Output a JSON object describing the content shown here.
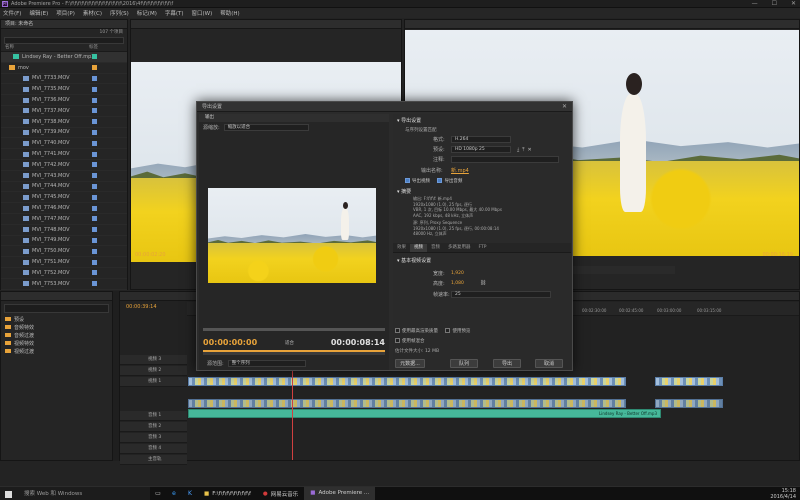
{
  "titlebar": {
    "title": "Adobe Premiere Pro - F:\\f\\f\\f\\f\\f\\f\\f\\f\\f\\f\\f\\f\\f\\f\\f\\2016\\4f\\f\\f\\f\\f\\f\\f\\f\\f\\f",
    "min": "—",
    "max": "☐",
    "close": "✕"
  },
  "menu": [
    "文件(F)",
    "编辑(E)",
    "项目(P)",
    "素材(C)",
    "序列(S)",
    "标记(M)",
    "字幕(T)",
    "窗口(W)",
    "帮助(H)"
  ],
  "project": {
    "header": "项目: 未命名",
    "items_label": "107 个项目",
    "search_placeholder": "",
    "col_name": "名称",
    "col_label": "标签",
    "items": [
      {
        "name": "Lindsey Ray - Better Off.mp3",
        "color": "#36c2a2",
        "kind": "audio"
      },
      {
        "name": "mov",
        "color": "#e8a33a",
        "kind": "folder"
      },
      {
        "name": "MVI_7733.MOV",
        "color": "#6a95d6",
        "kind": "video"
      },
      {
        "name": "MVI_7735.MOV",
        "color": "#6a95d6",
        "kind": "video"
      },
      {
        "name": "MVI_7736.MOV",
        "color": "#6a95d6",
        "kind": "video"
      },
      {
        "name": "MVI_7737.MOV",
        "color": "#6a95d6",
        "kind": "video"
      },
      {
        "name": "MVI_7738.MOV",
        "color": "#6a95d6",
        "kind": "video"
      },
      {
        "name": "MVI_7739.MOV",
        "color": "#6a95d6",
        "kind": "video"
      },
      {
        "name": "MVI_7740.MOV",
        "color": "#6a95d6",
        "kind": "video"
      },
      {
        "name": "MVI_7741.MOV",
        "color": "#6a95d6",
        "kind": "video"
      },
      {
        "name": "MVI_7742.MOV",
        "color": "#6a95d6",
        "kind": "video"
      },
      {
        "name": "MVI_7743.MOV",
        "color": "#6a95d6",
        "kind": "video"
      },
      {
        "name": "MVI_7744.MOV",
        "color": "#6a95d6",
        "kind": "video"
      },
      {
        "name": "MVI_7745.MOV",
        "color": "#6a95d6",
        "kind": "video"
      },
      {
        "name": "MVI_7746.MOV",
        "color": "#6a95d6",
        "kind": "video"
      },
      {
        "name": "MVI_7747.MOV",
        "color": "#6a95d6",
        "kind": "video"
      },
      {
        "name": "MVI_7748.MOV",
        "color": "#6a95d6",
        "kind": "video"
      },
      {
        "name": "MVI_7749.MOV",
        "color": "#6a95d6",
        "kind": "video"
      },
      {
        "name": "MVI_7750.MOV",
        "color": "#6a95d6",
        "kind": "video"
      },
      {
        "name": "MVI_7751.MOV",
        "color": "#6a95d6",
        "kind": "video"
      },
      {
        "name": "MVI_7752.MOV",
        "color": "#6a95d6",
        "kind": "video"
      },
      {
        "name": "MVI_7753.MOV",
        "color": "#6a95d6",
        "kind": "video"
      }
    ]
  },
  "source": {
    "timecode": "00:00:02:20"
  },
  "program": {
    "timecode": "00:00:16:19"
  },
  "export": {
    "title": "导出设置",
    "close": "✕",
    "tab_output": "输出",
    "source_range_label": "源缩放:",
    "source_range_value": "缩放以适合",
    "tc_in": "00:00:00:00",
    "tc_out": "00:00:08:14",
    "fit_label": "适合",
    "range_label": "源范围:",
    "range_value": "整个序列",
    "settings_header": "导出设置",
    "match_seq": "与序列设置匹配",
    "format_label": "格式:",
    "format_value": "H.264",
    "preset_label": "预设:",
    "preset_value": "HD 1080p 25",
    "comment_label": "注释:",
    "output_name_label": "输出名称:",
    "output_name_value": "新.mp4",
    "export_video": "导出视频",
    "export_audio": "导出音频",
    "summary_header": "摘要",
    "summary_output_lines": [
      "输出: F:\\f\\f\\f: 新.mp4",
      "1920x1080 (1.0), 25 fps, 逐行",
      "VBR, 1 次, 目标 10.00 Mbps, 最大 40.00 Mbps",
      "AAC, 192 kbps, 48 kHz, 立体声"
    ],
    "summary_source_lines": [
      "源: 序列, Proxy Sequence",
      "1920x1080 (1.0), 25 fps, 逐行, 00:00:08:14",
      "48000 Hz, 立体声"
    ],
    "tabs": [
      "效果",
      "视频",
      "音频",
      "多路复用器",
      "FTP"
    ],
    "basic_video_header": "基本视频设置",
    "width_label": "宽度:",
    "width_value": "1,920",
    "height_label": "高度:",
    "height_value": "1,080",
    "framerate_label": "帧速率:",
    "framerate_value": "25",
    "max_render": "使用最高渲染质量",
    "use_preview": "使用预览",
    "use_frame_blend": "使用帧混合",
    "file_size": "估计文件大小: 12 MB",
    "metadata_btn": "元数据...",
    "queue_btn": "队列",
    "export_btn": "导出",
    "cancel_btn": "取消"
  },
  "effects": {
    "items": [
      "预设",
      "音频特效",
      "音频过渡",
      "视频特效",
      "视频过渡"
    ]
  },
  "timeline": {
    "timecode": "00:00:39:14",
    "ruler": [
      "00:02:30:00",
      "00:02:45:00",
      "00:03:00:00",
      "00:03:15:00"
    ],
    "tracks_video": [
      "视频 3",
      "视频 2",
      "视频 1"
    ],
    "tracks_audio": [
      "音频 1",
      "音频 2",
      "音频 3",
      "音频 4"
    ],
    "master_label": "主音轨",
    "audio_clip": "Lindsey Ray - Better Off.mp3"
  },
  "taskbar": {
    "search": "搜索 Web 和 Windows",
    "tasks": [
      "F:\\f\\f\\f\\f\\f\\f\\f\\f\\f",
      "网易云音乐",
      "Adobe Premiere ..."
    ],
    "time": "15:18",
    "date": "2016/4/14"
  }
}
